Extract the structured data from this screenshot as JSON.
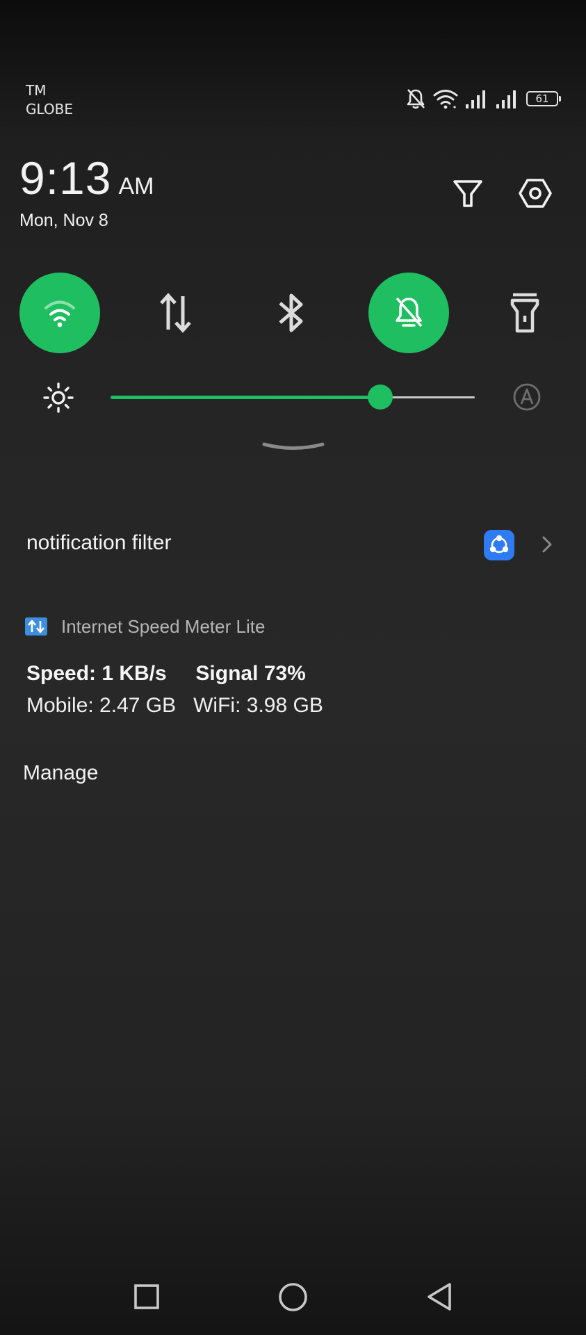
{
  "status_bar": {
    "carrier_line1": "TM",
    "carrier_line2": "GLOBE",
    "battery_level": "61",
    "icons": [
      "bell-off-icon",
      "wifi-icon",
      "signal-icon",
      "signal-icon",
      "battery-icon"
    ]
  },
  "header": {
    "time": "9:13",
    "ampm": "AM",
    "date": "Mon, Nov 8",
    "filter_icon": "filter-icon",
    "settings_icon": "settings-hex-icon"
  },
  "quick_tiles": [
    {
      "id": "wifi",
      "icon": "wifi-icon",
      "active": true
    },
    {
      "id": "mobile-data",
      "icon": "data-arrows-icon",
      "active": false
    },
    {
      "id": "bluetooth",
      "icon": "bluetooth-icon",
      "active": false
    },
    {
      "id": "do-not-disturb",
      "icon": "bell-off-icon",
      "active": true
    },
    {
      "id": "flashlight",
      "icon": "flashlight-icon",
      "active": false
    }
  ],
  "brightness": {
    "level": 0.74,
    "auto_icon": "auto-brightness-icon"
  },
  "notification_filter": {
    "label": "notification filter",
    "app_icon": "shareit-icon"
  },
  "speed_notification": {
    "app_name": "Internet Speed Meter Lite",
    "line1": "Speed: 1 KB/s     Signal 73%",
    "line2": "Mobile: 2.47 GB   WiFi: 3.98 GB"
  },
  "manage_label": "Manage",
  "colors": {
    "accent": "#1fbe61",
    "background": "#262626",
    "text": "#f5f5f5",
    "muted_text": "#b5b5b5"
  },
  "nav_bar": {
    "icons": [
      "recents-icon",
      "home-icon",
      "back-icon"
    ]
  }
}
